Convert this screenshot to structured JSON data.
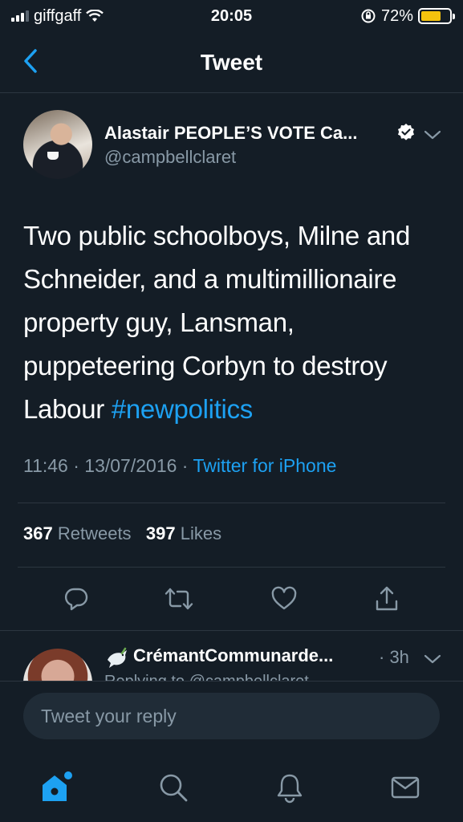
{
  "status_bar": {
    "carrier": "giffgaff",
    "time": "20:05",
    "battery_percent": "72%",
    "battery_level": 0.72
  },
  "nav": {
    "title": "Tweet",
    "back_icon": "chevron-left-icon"
  },
  "tweet": {
    "author_name": "Alastair PEOPLE’S VOTE Ca...",
    "handle": "@campbellclaret",
    "verified": true,
    "text": "Two public schoolboys, Milne and Schneider, and a multimillionaire property guy, Lansman, puppeteering Corbyn to destroy Labour ",
    "hashtag": "#newpolitics",
    "timestamp": "11:46 · 13/07/2016 · ",
    "source": "Twitter for iPhone",
    "retweets_count": "367",
    "retweets_label": "Retweets",
    "likes_count": "397",
    "likes_label": "Likes"
  },
  "actions": [
    {
      "icon": "reply-icon"
    },
    {
      "icon": "retweet-icon"
    },
    {
      "icon": "like-icon"
    },
    {
      "icon": "share-icon"
    }
  ],
  "reply_preview": {
    "name": "CrémantCommunarde...",
    "time": "· 3h",
    "sub": "Replying to @campbellclaret"
  },
  "composer": {
    "placeholder": "Tweet your reply"
  },
  "tabs": [
    {
      "icon": "home-icon",
      "active": true
    },
    {
      "icon": "search-icon",
      "active": false
    },
    {
      "icon": "notifications-icon",
      "active": false
    },
    {
      "icon": "messages-icon",
      "active": false
    }
  ],
  "colors": {
    "background": "#141d26",
    "accent": "#1da1f2",
    "secondary_text": "#8899a6",
    "battery": "#f4c20d"
  }
}
